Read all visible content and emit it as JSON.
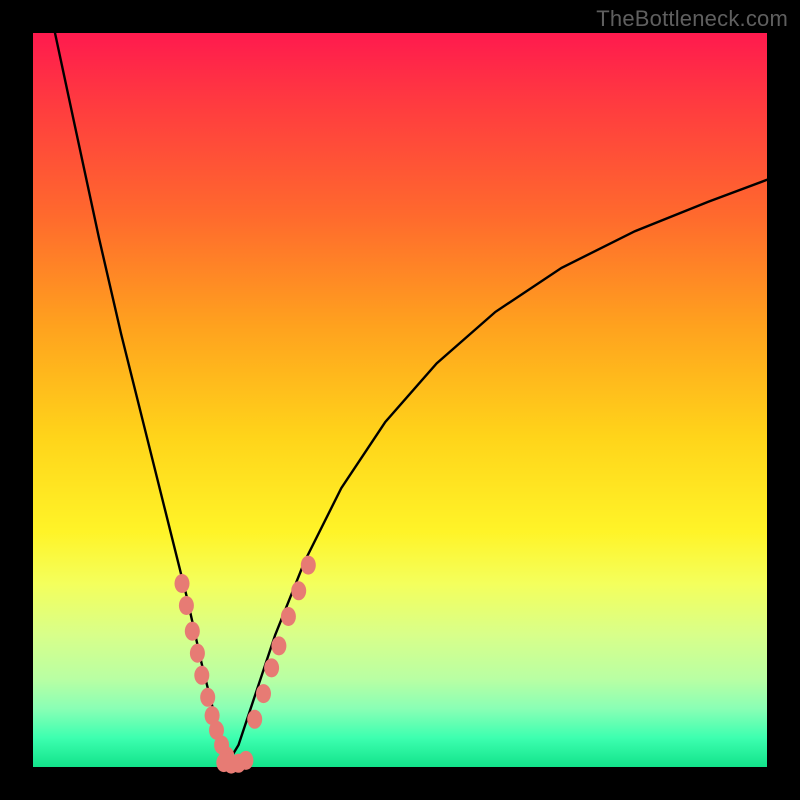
{
  "brand": "TheBottleneck.com",
  "chart_data": {
    "type": "line",
    "title": "",
    "xlabel": "",
    "ylabel": "",
    "xlim": [
      0,
      100
    ],
    "ylim": [
      0,
      100
    ],
    "note": "V-shaped bottleneck curve; minimum near x≈27. Values are relative (0–100) read from plot area.",
    "series": [
      {
        "name": "curve",
        "x": [
          3,
          6,
          9,
          12,
          15,
          18,
          21,
          23,
          25,
          26.5,
          28,
          30,
          33,
          37,
          42,
          48,
          55,
          63,
          72,
          82,
          92,
          100
        ],
        "y": [
          100,
          86,
          72,
          59,
          47,
          35,
          23,
          14,
          6,
          0.5,
          3,
          9,
          18,
          28,
          38,
          47,
          55,
          62,
          68,
          73,
          77,
          80
        ]
      },
      {
        "name": "left-dots",
        "x": [
          20.3,
          20.9,
          21.7,
          22.4,
          23.0,
          23.8,
          24.4,
          25.0,
          25.7,
          26.4
        ],
        "y": [
          25.0,
          22.0,
          18.5,
          15.5,
          12.5,
          9.5,
          7.0,
          5.0,
          3.0,
          1.5
        ]
      },
      {
        "name": "bottom-dots",
        "x": [
          26.0,
          27.0,
          28.0,
          29.0
        ],
        "y": [
          0.6,
          0.4,
          0.5,
          0.9
        ]
      },
      {
        "name": "right-dots",
        "x": [
          30.2,
          31.4,
          32.5,
          33.5,
          34.8,
          36.2,
          37.5
        ],
        "y": [
          6.5,
          10.0,
          13.5,
          16.5,
          20.5,
          24.0,
          27.5
        ]
      }
    ],
    "colors": {
      "curve": "#000000",
      "dots": "#e77b74",
      "gradient_top": "#ff1a4e",
      "gradient_bottom": "#12e38a"
    }
  }
}
